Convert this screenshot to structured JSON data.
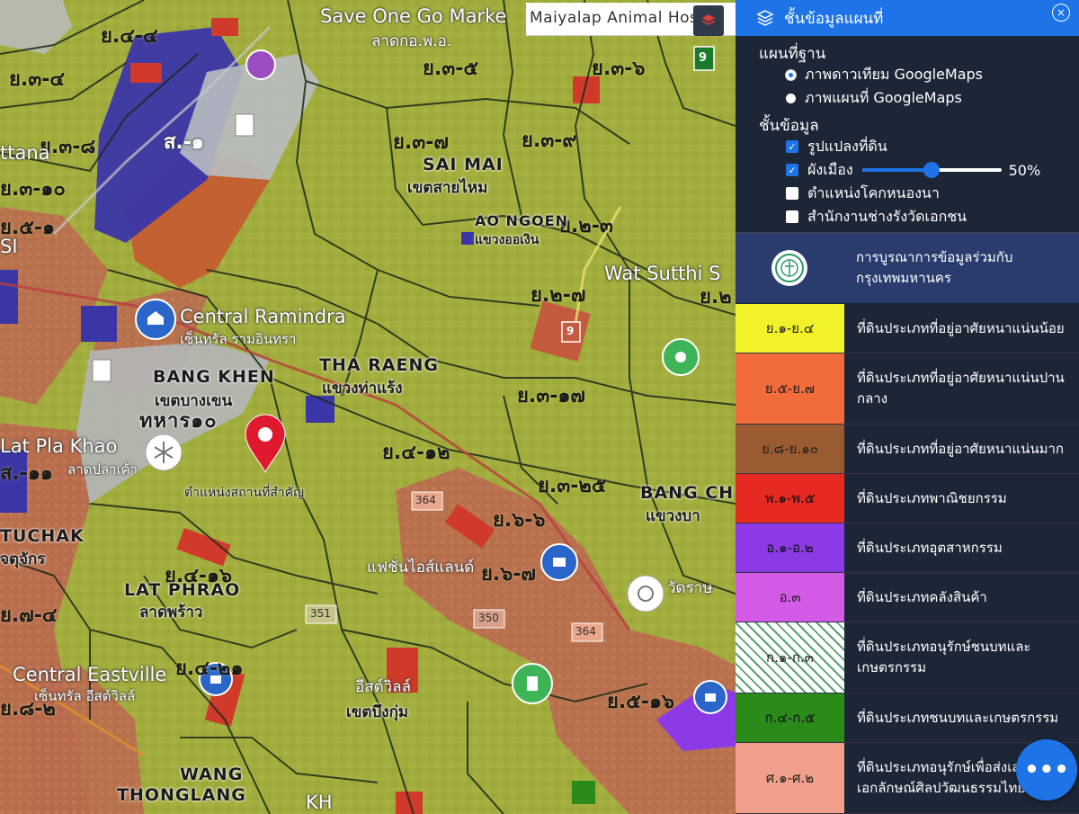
{
  "search": {
    "text": "Maiyalap Animal Hospital"
  },
  "map": {
    "zone_labels": [
      "ย.๔-๔",
      "ย.๓-๔",
      "ย.๓-๘",
      "ย.๓-๑๐",
      "ย.๕-๑",
      "ส.-๑",
      "ย.๓-๗",
      "ย.๓-๙",
      "ย.๓-๕",
      "ย.๓-๖",
      "ย.๒-๓",
      "ย.๒-๗",
      "ย.๓-๑๗",
      "ย.๔-๑๒",
      "ย.๓-๒๕",
      "ย.๖-๖",
      "ย.๔-๑๖",
      "ย.๔-๒๑",
      "ย.๕-๑๖",
      "ย.๖-๗",
      "ย.๗-๔",
      "ย.๘-๒",
      "ส.-๑๑",
      "ย.๒"
    ],
    "place_labels": {
      "saimai": "SAI MAI",
      "saimai_th": "เขตสายไหม",
      "tharaeng": "THA RAENG",
      "tharaeng_th": "แขวงท่าแร้ง",
      "bangkhen": "BANG KHEN",
      "bangkhen_th": "เขตบางเขน",
      "latphrao": "LAT PHRAO",
      "latphrao_th": "ลาดพร้าว",
      "chatuchak": "TUCHAK",
      "chatuchak_th": "จตุจักร",
      "wangthonglang": "WANG",
      "wangthonglang2": "THONGLANG",
      "bungkum_th": "เขตบึงกุ่ม",
      "bangchan": "BANG CH",
      "bangchan_th": "แขวงบา",
      "aongoen": "AO NGOEN",
      "aongoen_th": "แขวงออเงิน",
      "wat": "Wat Sutthi S",
      "centralramindra": "Central Ramindra",
      "centralramindra_th": "เซ็นทรัล รามอินทรา",
      "centraleastville": "Central Eastville",
      "centraleastville_th": "เซ็นทรัล อีสต์วิลล์",
      "latplakhao": "Lat Pla Khao",
      "latplakhao_th": "ลาดปลาเค้า",
      "save1": "Save One Go Marke",
      "save2": "ลาดกอ.พ.อ.",
      "aotaraw": "ทหาร๑๐",
      "fashion": "แฟชั่นไอส์แลนด์",
      "eastville_th": "อีสต์วิลล์",
      "watraw": "วัดราษ",
      "attaana": "ttana",
      "si": "SI",
      "kh": "KH",
      "pinned": "ตำแหน่งสถานที่สำคัญ"
    },
    "route_badges": [
      "9",
      "9",
      "364",
      "351",
      "350",
      "364"
    ]
  },
  "panel": {
    "title": "ชั้นข้อมูลแผนที่",
    "basemap_title": "แผนที่ฐาน",
    "basemap_options": [
      {
        "label": "ภาพดาวเทียม GoogleMaps",
        "selected": true
      },
      {
        "label": "ภาพแผนที่ GoogleMaps",
        "selected": false
      }
    ],
    "layers_title": "ชั้นข้อมูล",
    "layers": [
      {
        "label": "รูปแปลงที่ดิน",
        "checked": true
      },
      {
        "label": "ผังเมือง",
        "checked": true
      },
      {
        "label": "ตำแหน่งโคกหนองนา",
        "checked": false
      },
      {
        "label": "สำนักงานช่างรังวัดเอกชน",
        "checked": false
      }
    ],
    "opacity_percent": 50,
    "opacity_label": "50%",
    "bma_text_1": "การบูรณาการข้อมูลร่วมกับ",
    "bma_text_2": "กรุงเทพมหานคร"
  },
  "legend": [
    {
      "code": "ย.๑-ย.๔",
      "desc": "ที่ดินประเภทที่อยู่อาศัยหนาแน่นน้อย",
      "color": "#f2f22a",
      "h": 54
    },
    {
      "code": "ย.๕-ย.๗",
      "desc": "ที่ดินประเภทที่อยู่อาศัยหนาแน่นปานกลาง",
      "color": "#f26b3a",
      "h": 78
    },
    {
      "code": "ย.๘-ย.๑๐",
      "desc": "ที่ดินประเภทที่อยู่อาศัยหนาแน่นมาก",
      "color": "#9b5b32",
      "h": 54
    },
    {
      "code": "พ.๑-พ.๕",
      "desc": "ที่ดินประเภทพาณิชยกรรม",
      "color": "#e62a22",
      "h": 54
    },
    {
      "code": "อ.๑-อ.๒",
      "desc": "ที่ดินประเภทอุตสาหกรรม",
      "color": "#8c3ae6",
      "h": 54
    },
    {
      "code": "อ.๓",
      "desc": "ที่ดินประเภทคลังสินค้า",
      "color": "#d35ae6",
      "h": 54
    },
    {
      "code": "ก.๑-ก.๓",
      "desc": "ที่ดินประเภทอนุรักษ์ชนบทและเกษตรกรรม",
      "color": "#ffffff",
      "h": 78
    },
    {
      "code": "ก.๔-ก.๕",
      "desc": "ที่ดินประเภทชนบทและเกษตรกรรม",
      "color": "#2a8a1a",
      "h": 54
    },
    {
      "code": "ศ.๑-ศ.๒",
      "desc": "ที่ดินประเภทอนุรักษ์เพื่อส่งเสริมเอกลักษณ์ศิลปวัฒนธรรมไทย",
      "color": "#f0a08a",
      "h": 78
    }
  ],
  "colors": {
    "panel_bg": "#1d2636",
    "accent": "#1e74e6",
    "map_base": "#9aa83a"
  }
}
